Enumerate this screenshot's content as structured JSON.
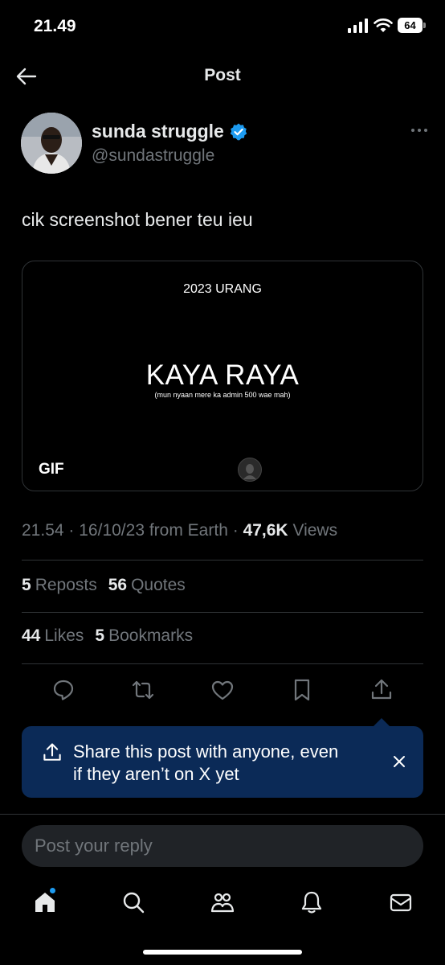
{
  "status_bar": {
    "time": "21.49",
    "battery": "64"
  },
  "header": {
    "title": "Post"
  },
  "author": {
    "display_name": "sunda struggle",
    "handle": "@sundastruggle",
    "verified": true
  },
  "post": {
    "text": "cik screenshot bener teu ieu"
  },
  "media": {
    "top_text": "2023 URANG",
    "headline": "KAYA RAYA",
    "subtext": "(mun nyaan mere ka admin 500 wae mah)",
    "badge": "GIF"
  },
  "meta": {
    "time": "21.54",
    "date": "16/10/23",
    "source": "from Earth",
    "views_count": "47,6K",
    "views_label": "Views"
  },
  "stats": {
    "reposts": {
      "count": "5",
      "label": "Reposts"
    },
    "quotes": {
      "count": "56",
      "label": "Quotes"
    },
    "likes": {
      "count": "44",
      "label": "Likes"
    },
    "bookmarks": {
      "count": "5",
      "label": "Bookmarks"
    }
  },
  "share_toast": {
    "line1": "Share this post with anyone, even",
    "line2": "if they aren’t on X yet"
  },
  "reply": {
    "placeholder": "Post your reply"
  },
  "colors": {
    "accent": "#1d9bf0",
    "toast_bg": "#0b2a57",
    "muted": "#71767b",
    "text": "#e7e9ea"
  },
  "icons": [
    "back-arrow-icon",
    "verified-badge-icon",
    "more-icon",
    "reply-icon",
    "repost-icon",
    "like-icon",
    "bookmark-icon",
    "share-icon",
    "close-icon",
    "home-icon",
    "search-icon",
    "communities-icon",
    "notifications-icon",
    "messages-icon"
  ]
}
